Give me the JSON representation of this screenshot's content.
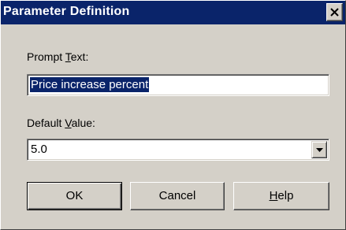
{
  "dialog": {
    "title": "Parameter Definition"
  },
  "prompt": {
    "label_pre": "Prompt ",
    "label_mnemonic": "T",
    "label_post": "ext:",
    "value": "Price increase percent"
  },
  "default_value": {
    "label_pre": "Default ",
    "label_mnemonic": "V",
    "label_post": "alue:",
    "value": "5.0"
  },
  "buttons": {
    "ok_label": "OK",
    "cancel_label": "Cancel",
    "help_mnemonic": "H",
    "help_post": "elp"
  },
  "icons": {
    "close": "close-icon",
    "dropdown": "chevron-down-icon"
  },
  "colors": {
    "titlebar": "#0a246a",
    "face": "#d4d0c8",
    "selection": "#0a246a"
  }
}
